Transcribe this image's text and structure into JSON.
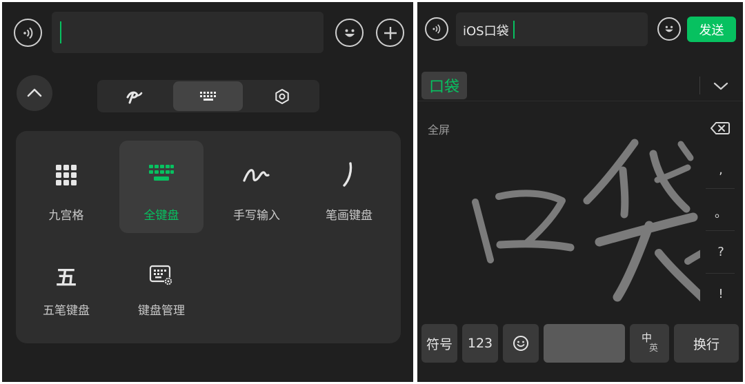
{
  "left": {
    "tabs": [
      {
        "name": "sougou-logo-tab",
        "icon": "sougou-logo-icon"
      },
      {
        "name": "keyboard-tab",
        "icon": "keyboard-icon"
      },
      {
        "name": "settings-tab",
        "icon": "hexagon-settings-icon"
      }
    ],
    "options": [
      {
        "label": "九宫格",
        "icon": "nine-grid-icon",
        "selected": false
      },
      {
        "label": "全键盘",
        "icon": "full-keyboard-icon",
        "selected": true
      },
      {
        "label": "手写输入",
        "icon": "handwriting-icon",
        "selected": false
      },
      {
        "label": "笔画键盘",
        "icon": "stroke-icon",
        "selected": false
      },
      {
        "label": "五笔键盘",
        "icon": "wubi-icon",
        "icon_text": "五",
        "selected": false
      },
      {
        "label": "键盘管理",
        "icon": "keyboard-settings-icon",
        "selected": false
      }
    ]
  },
  "right": {
    "input_value": "iOS口袋",
    "send_label": "发送",
    "candidate": "口袋",
    "fullscreen_label": "全屏",
    "punctuation": [
      ",",
      "。",
      "?",
      "!"
    ],
    "handwriting_strokes": "口袋",
    "bottom_keys": {
      "symbols": "符号",
      "numbers": "123",
      "lang_top": "中",
      "lang_bottom": "英",
      "enter": "换行"
    }
  },
  "colors": {
    "background": "#1f1f1f",
    "accent": "#07c160",
    "tile": "#2e2e2e",
    "key": "#3a3a3a"
  }
}
